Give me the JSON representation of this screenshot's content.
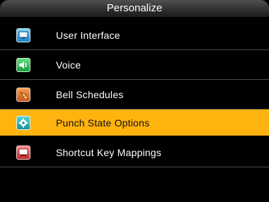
{
  "header": {
    "title": "Personalize"
  },
  "menu": {
    "selected_index": 3,
    "items": [
      {
        "label": "User Interface",
        "icon": "monitor-icon"
      },
      {
        "label": "Voice",
        "icon": "speaker-icon"
      },
      {
        "label": "Bell Schedules",
        "icon": "bell-icon"
      },
      {
        "label": "Punch State Options",
        "icon": "gear-icon"
      },
      {
        "label": "Shortcut Key Mappings",
        "icon": "keyboard-key-icon"
      }
    ]
  },
  "colors": {
    "selected_bg": "#ffb30e",
    "background": "#000000",
    "divider": "#4a4a4a"
  }
}
